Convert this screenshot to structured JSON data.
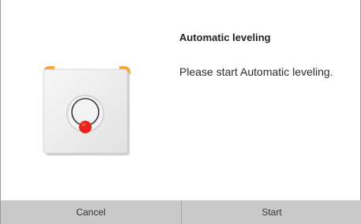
{
  "dialog": {
    "title": "Automatic leveling",
    "message": "Please start Automatic leveling."
  },
  "buttons": {
    "cancel": "Cancel",
    "start": "Start"
  },
  "illustration": {
    "icon": "leveling-plate-icon",
    "corner_color": "#f4a32c",
    "probe_color": "#e8231b"
  }
}
